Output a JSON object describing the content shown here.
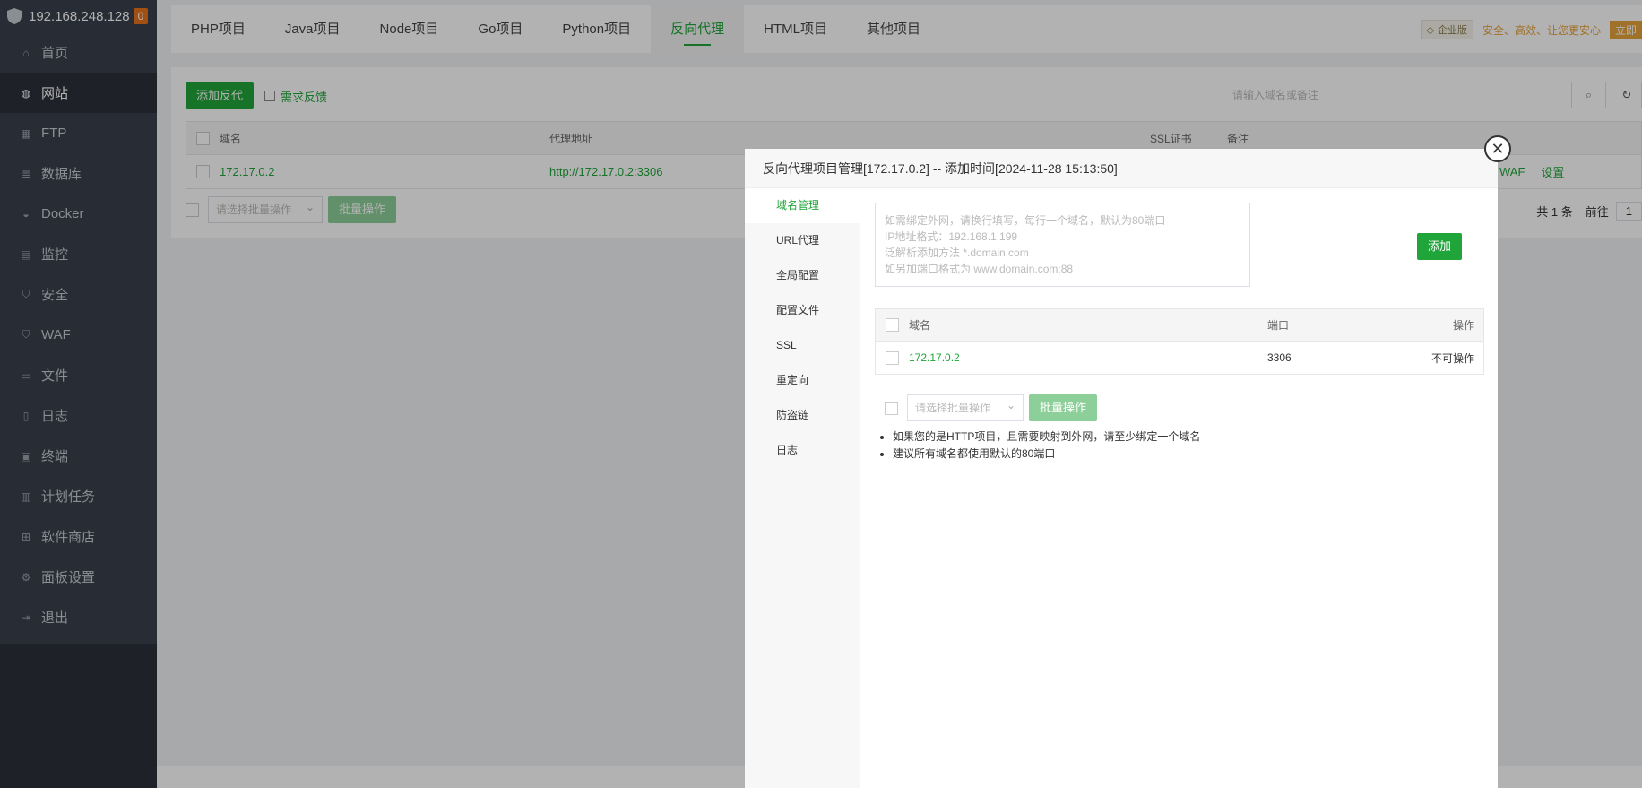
{
  "sidebar": {
    "host": "192.168.248.128",
    "badge": "0",
    "items": [
      {
        "label": "首页",
        "icon": "home-icon"
      },
      {
        "label": "网站",
        "icon": "globe-icon",
        "active": true
      },
      {
        "label": "FTP",
        "icon": "ftp-icon"
      },
      {
        "label": "数据库",
        "icon": "database-icon"
      },
      {
        "label": "Docker",
        "icon": "docker-icon"
      },
      {
        "label": "监控",
        "icon": "monitor-icon"
      },
      {
        "label": "安全",
        "icon": "shield-icon"
      },
      {
        "label": "WAF",
        "icon": "waf-icon"
      },
      {
        "label": "文件",
        "icon": "folder-icon"
      },
      {
        "label": "日志",
        "icon": "log-icon"
      },
      {
        "label": "终端",
        "icon": "terminal-icon"
      },
      {
        "label": "计划任务",
        "icon": "calendar-icon"
      },
      {
        "label": "软件商店",
        "icon": "grid-icon"
      },
      {
        "label": "面板设置",
        "icon": "gear-icon"
      },
      {
        "label": "退出",
        "icon": "logout-icon"
      }
    ]
  },
  "tabs": [
    "PHP项目",
    "Java项目",
    "Node项目",
    "Go项目",
    "Python项目",
    "反向代理",
    "HTML项目",
    "其他项目"
  ],
  "active_tab": "反向代理",
  "header_right": {
    "badge": "企业版",
    "slogan": "安全、高效、让您更安心",
    "buy": "立即"
  },
  "toolbar": {
    "add_label": "添加反代",
    "feedback_label": "需求反馈",
    "search_placeholder": "请输入域名或备注"
  },
  "table": {
    "headers": {
      "domain": "域名",
      "proxy": "代理地址",
      "ssl": "SSL证书",
      "remark": "备注"
    },
    "rows": [
      {
        "domain": "172.17.0.2",
        "proxy": "http://172.17.0.2:3306",
        "waf": "WAF",
        "settings": "设置"
      }
    ]
  },
  "batch": {
    "select_placeholder": "请选择批量操作",
    "button": "批量操作"
  },
  "pager": {
    "total": "共 1 条",
    "goto": "前往",
    "page": "1"
  },
  "modal": {
    "title": "反向代理项目管理[172.17.0.2] -- 添加时间[2024-11-28 15:13:50]",
    "nav": [
      "域名管理",
      "URL代理",
      "全局配置",
      "配置文件",
      "SSL",
      "重定向",
      "防盗链",
      "日志"
    ],
    "active_nav": "域名管理",
    "textarea_placeholder": [
      "如需绑定外网，请换行填写，每行一个域名，默认为80端口",
      "IP地址格式：192.168.1.199",
      "泛解析添加方法 *.domain.com",
      "如另加端口格式为 www.domain.com:88"
    ],
    "add_button": "添加",
    "table": {
      "headers": {
        "domain": "域名",
        "port": "端口",
        "action": "操作"
      },
      "rows": [
        {
          "domain": "172.17.0.2",
          "port": "3306",
          "action": "不可操作"
        }
      ]
    },
    "batch_select_placeholder": "请选择批量操作",
    "batch_button": "批量操作",
    "tips": [
      "如果您的是HTTP项目，且需要映射到外网，请至少绑定一个域名",
      "建议所有域名都使用默认的80端口"
    ]
  },
  "colors": {
    "accent": "#20a53a",
    "sidebar": "#3a404b",
    "warning": "#e6a23c"
  }
}
